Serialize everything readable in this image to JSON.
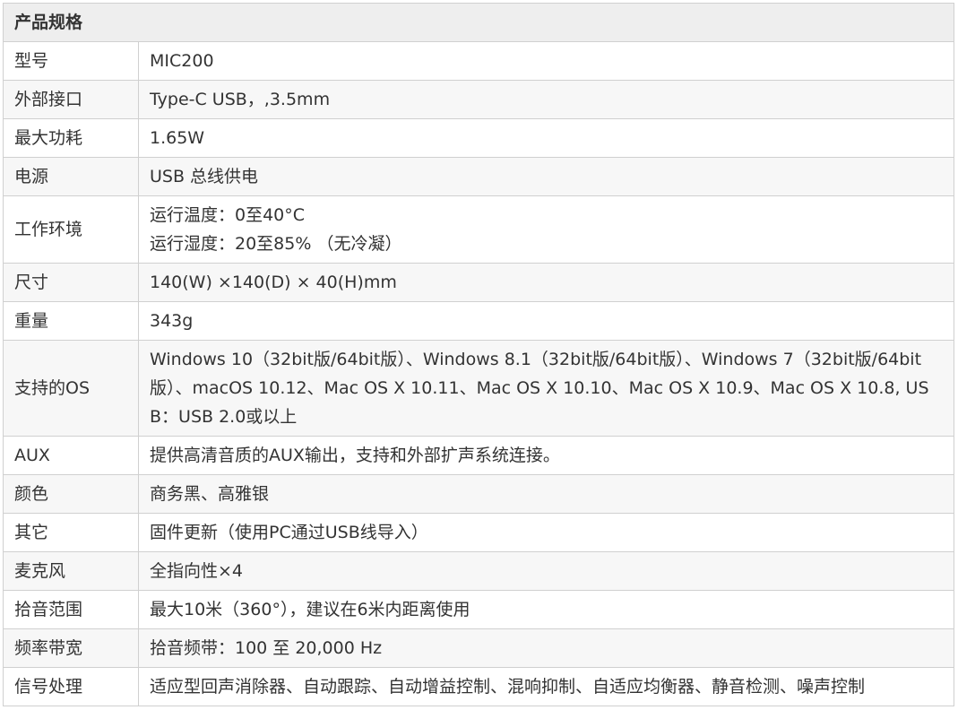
{
  "header": "产品规格",
  "rows": [
    {
      "label": "型号",
      "value": "MIC200"
    },
    {
      "label": "外部接口",
      "value": "Type-C USB，,3.5mm"
    },
    {
      "label": "最大功耗",
      "value": "1.65W"
    },
    {
      "label": "电源",
      "value": "USB 总线供电"
    },
    {
      "label": "工作环境",
      "line1": "运行温度：0至40°C",
      "line2": "运行湿度：20至85% （无冷凝）"
    },
    {
      "label": "尺寸",
      "value": "140(W) ×140(D) × 40(H)mm"
    },
    {
      "label": "重量",
      "value": "343g"
    },
    {
      "label": "支持的OS",
      "value": "Windows 10（32bit版/64bit版）、Windows 8.1（32bit版/64bit版）、Windows 7（32bit版/64bit版）、macOS 10.12、Mac OS X 10.11、Mac OS X 10.10、Mac OS X 10.9、Mac OS X 10.8, USB：USB 2.0或以上"
    },
    {
      "label": "AUX",
      "value": "提供高清音质的AUX输出，支持和外部扩声系统连接。"
    },
    {
      "label": "颜色",
      "value": "商务黑、高雅银"
    },
    {
      "label": "其它",
      "value": "固件更新（使用PC通过USB线导入）"
    },
    {
      "label": "麦克风",
      "value": "全指向性×4"
    },
    {
      "label": "拾音范围",
      "value": "最大10米（360°），建议在6米内距离使用"
    },
    {
      "label": "频率带宽",
      "value": "拾音频带：100 至 20,000 Hz"
    },
    {
      "label": "信号处理",
      "value": "适应型回声消除器、自动跟踪、自动增益控制、混响抑制、自适应均衡器、静音检测、噪声控制"
    }
  ]
}
